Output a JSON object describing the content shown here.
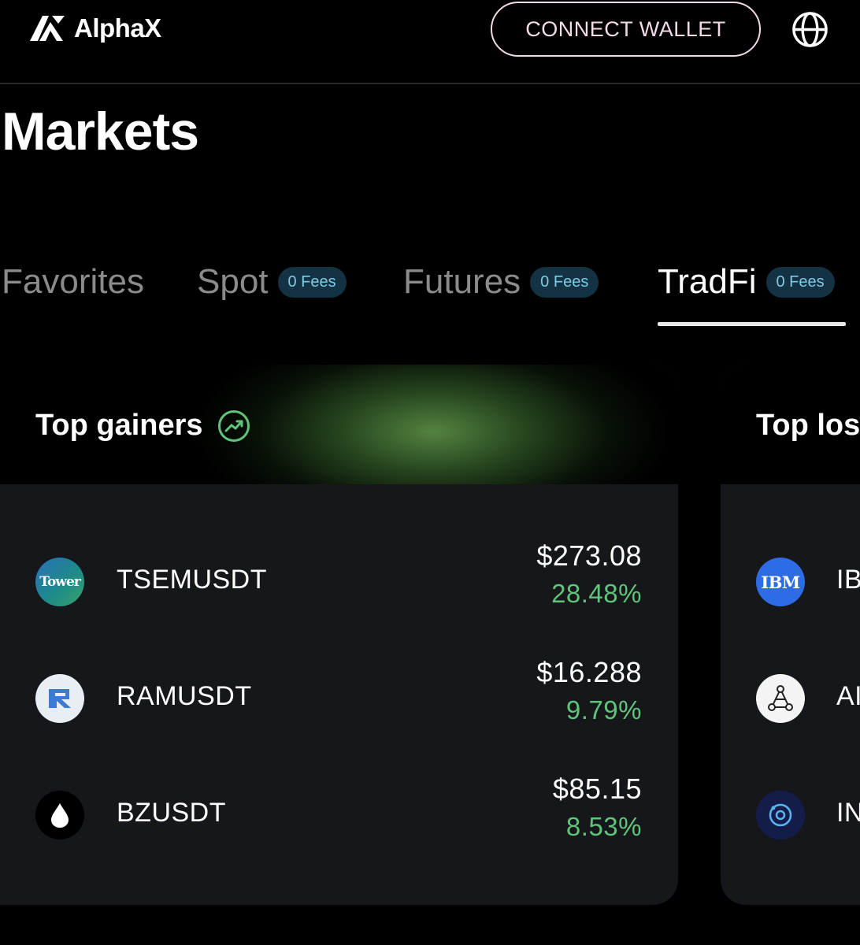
{
  "header": {
    "logo_text": "AlphaX",
    "connect_label": "CONNECT WALLET"
  },
  "page": {
    "title": "Markets"
  },
  "tabs": [
    {
      "label": "Favorites",
      "badge": ""
    },
    {
      "label": "Spot",
      "badge": "0 Fees"
    },
    {
      "label": "Futures",
      "badge": "0 Fees"
    },
    {
      "label": "TradFi",
      "badge": "0 Fees",
      "active": true
    }
  ],
  "gainers": {
    "title": "Top gainers",
    "rows": [
      {
        "symbol": "TSEMUSDT",
        "price": "$273.08",
        "change": "28.48%",
        "icon": "tower-logo",
        "icon_text": "Tower"
      },
      {
        "symbol": "RAMUSDT",
        "price": "$16.288",
        "change": "9.79%",
        "icon": "ram-logo"
      },
      {
        "symbol": "BZUSDT",
        "price": "$85.15",
        "change": "8.53%",
        "icon": "drop-logo"
      }
    ]
  },
  "losers": {
    "title": "Top los",
    "rows": [
      {
        "symbol": "IB",
        "icon": "ibm-logo",
        "icon_text": "IBM"
      },
      {
        "symbol": "AI",
        "icon": "network-logo"
      },
      {
        "symbol": "IN",
        "icon": "orbit-logo"
      }
    ]
  },
  "colors": {
    "positive": "#5fc57a",
    "badge_bg": "#133344",
    "badge_text": "#7ecbe6",
    "card_bg": "#16171a"
  }
}
